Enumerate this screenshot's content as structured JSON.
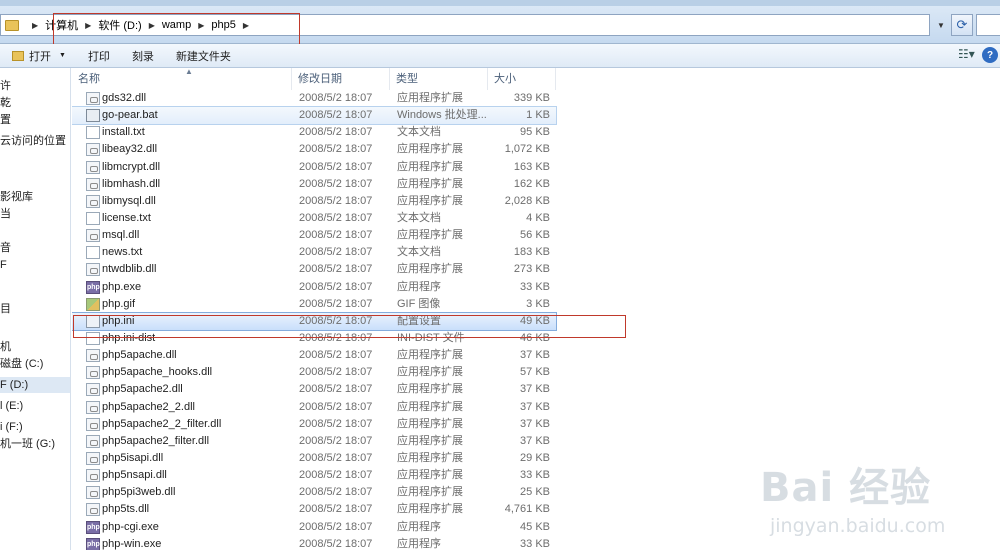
{
  "breadcrumb": [
    "计算机",
    "软件 (D:)",
    "wamp",
    "php5"
  ],
  "toolbar": {
    "open": "打开",
    "print": "打印",
    "burn": "刻录",
    "new_folder": "新建文件夹",
    "help": "?"
  },
  "nav_items": [
    "许",
    "乾",
    "置",
    "云访问的位置",
    "影视库",
    "当",
    "",
    "音",
    "F",
    "目",
    "机",
    "磁盘 (C:)",
    "F (D:)",
    "l (E:)",
    "i (F:)",
    "机一班 (G:)"
  ],
  "columns": {
    "name": "名称",
    "date": "修改日期",
    "type": "类型",
    "size": "大小"
  },
  "files": [
    {
      "name": "gds32.dll",
      "date": "2008/5/2 18:07",
      "type": "应用程序扩展",
      "size": "339 KB",
      "icon": "dll-icon"
    },
    {
      "name": "go-pear.bat",
      "date": "2008/5/2 18:07",
      "type": "Windows 批处理...",
      "size": "1 KB",
      "icon": "bat-icon"
    },
    {
      "name": "install.txt",
      "date": "2008/5/2 18:07",
      "type": "文本文档",
      "size": "95 KB",
      "icon": "txt-icon"
    },
    {
      "name": "libeay32.dll",
      "date": "2008/5/2 18:07",
      "type": "应用程序扩展",
      "size": "1,072 KB",
      "icon": "dll-icon"
    },
    {
      "name": "libmcrypt.dll",
      "date": "2008/5/2 18:07",
      "type": "应用程序扩展",
      "size": "163 KB",
      "icon": "dll-icon"
    },
    {
      "name": "libmhash.dll",
      "date": "2008/5/2 18:07",
      "type": "应用程序扩展",
      "size": "162 KB",
      "icon": "dll-icon"
    },
    {
      "name": "libmysql.dll",
      "date": "2008/5/2 18:07",
      "type": "应用程序扩展",
      "size": "2,028 KB",
      "icon": "dll-icon"
    },
    {
      "name": "license.txt",
      "date": "2008/5/2 18:07",
      "type": "文本文档",
      "size": "4 KB",
      "icon": "txt-icon"
    },
    {
      "name": "msql.dll",
      "date": "2008/5/2 18:07",
      "type": "应用程序扩展",
      "size": "56 KB",
      "icon": "dll-icon"
    },
    {
      "name": "news.txt",
      "date": "2008/5/2 18:07",
      "type": "文本文档",
      "size": "183 KB",
      "icon": "txt-icon"
    },
    {
      "name": "ntwdblib.dll",
      "date": "2008/5/2 18:07",
      "type": "应用程序扩展",
      "size": "273 KB",
      "icon": "dll-icon"
    },
    {
      "name": "php.exe",
      "date": "2008/5/2 18:07",
      "type": "应用程序",
      "size": "33 KB",
      "icon": "php-exe-icon"
    },
    {
      "name": "php.gif",
      "date": "2008/5/2 18:07",
      "type": "GIF 图像",
      "size": "3 KB",
      "icon": "gif-icon"
    },
    {
      "name": "php.ini",
      "date": "2008/5/2 18:07",
      "type": "配置设置",
      "size": "49 KB",
      "icon": "ini-icon"
    },
    {
      "name": "php.ini-dist",
      "date": "2008/5/2 18:07",
      "type": "INI-DIST 文件",
      "size": "46 KB",
      "icon": "txt-icon"
    },
    {
      "name": "php5apache.dll",
      "date": "2008/5/2 18:07",
      "type": "应用程序扩展",
      "size": "37 KB",
      "icon": "dll-icon"
    },
    {
      "name": "php5apache_hooks.dll",
      "date": "2008/5/2 18:07",
      "type": "应用程序扩展",
      "size": "57 KB",
      "icon": "dll-icon"
    },
    {
      "name": "php5apache2.dll",
      "date": "2008/5/2 18:07",
      "type": "应用程序扩展",
      "size": "37 KB",
      "icon": "dll-icon"
    },
    {
      "name": "php5apache2_2.dll",
      "date": "2008/5/2 18:07",
      "type": "应用程序扩展",
      "size": "37 KB",
      "icon": "dll-icon"
    },
    {
      "name": "php5apache2_2_filter.dll",
      "date": "2008/5/2 18:07",
      "type": "应用程序扩展",
      "size": "37 KB",
      "icon": "dll-icon"
    },
    {
      "name": "php5apache2_filter.dll",
      "date": "2008/5/2 18:07",
      "type": "应用程序扩展",
      "size": "37 KB",
      "icon": "dll-icon"
    },
    {
      "name": "php5isapi.dll",
      "date": "2008/5/2 18:07",
      "type": "应用程序扩展",
      "size": "29 KB",
      "icon": "dll-icon"
    },
    {
      "name": "php5nsapi.dll",
      "date": "2008/5/2 18:07",
      "type": "应用程序扩展",
      "size": "33 KB",
      "icon": "dll-icon"
    },
    {
      "name": "php5pi3web.dll",
      "date": "2008/5/2 18:07",
      "type": "应用程序扩展",
      "size": "25 KB",
      "icon": "dll-icon"
    },
    {
      "name": "php5ts.dll",
      "date": "2008/5/2 18:07",
      "type": "应用程序扩展",
      "size": "4,761 KB",
      "icon": "dll-icon"
    },
    {
      "name": "php-cgi.exe",
      "date": "2008/5/2 18:07",
      "type": "应用程序",
      "size": "45 KB",
      "icon": "php-exe-icon"
    },
    {
      "name": "php-win.exe",
      "date": "2008/5/2 18:07",
      "type": "应用程序",
      "size": "33 KB",
      "icon": "php-exe-icon"
    }
  ],
  "hover_row": "go-pear.bat",
  "selected_row": "php.ini",
  "watermark": {
    "logo": "Bai 经验",
    "url": "jingyan.baidu.com"
  },
  "colors": {
    "highlight_box": "#c0392b",
    "selection": "#c9dffb"
  }
}
